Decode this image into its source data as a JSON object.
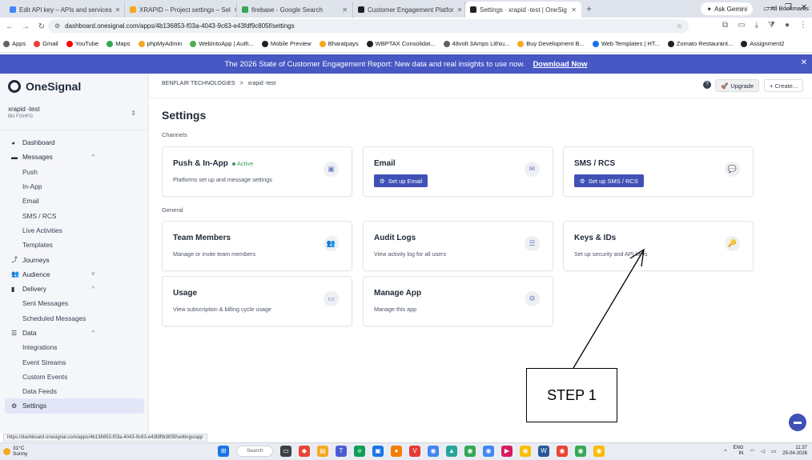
{
  "browser": {
    "tabs": [
      {
        "title": "Edit API key – APIs and services",
        "color": "#4285f4",
        "active": false
      },
      {
        "title": "XRAPID – Project settings – Sel",
        "color": "#f6a821",
        "active": false
      },
      {
        "title": "firebase - Google Search",
        "color": "#34a853",
        "active": false
      },
      {
        "title": "Customer Engagement Platfor",
        "color": "#202124",
        "active": false
      },
      {
        "title": "Settings · xrapid -test | OneSig",
        "color": "#202124",
        "active": true
      }
    ],
    "gemini_label": "Ask Gemini",
    "url": "dashboard.onesignal.com/apps/4b136853-f03a-4043-9c63-e43fdf9c805f/settings",
    "bookmarks": [
      {
        "label": "Apps",
        "color": "#5f6368"
      },
      {
        "label": "Gmail",
        "color": "#ea4335"
      },
      {
        "label": "YouTube",
        "color": "#ff0000"
      },
      {
        "label": "Maps",
        "color": "#34a853"
      },
      {
        "label": "phpMyAdmin",
        "color": "#f6a821"
      },
      {
        "label": "WebIntoApp | Auth...",
        "color": "#4caf50"
      },
      {
        "label": "Mobile Preview",
        "color": "#202124"
      },
      {
        "label": "Bharatpays",
        "color": "#f6a821"
      },
      {
        "label": "WBPTAX Consolidat...",
        "color": "#202124"
      },
      {
        "label": "48volt 3Amps Lithiu...",
        "color": "#5f6368"
      },
      {
        "label": "Buy Development B...",
        "color": "#f6a821"
      },
      {
        "label": "Web Templates | HT...",
        "color": "#1a73e8"
      },
      {
        "label": "Zomato Restaurant...",
        "color": "#202124"
      },
      {
        "label": "Assignment2",
        "color": "#202124"
      }
    ],
    "all_bookmarks_label": "All Bookmarks"
  },
  "banner": {
    "text": "The 2026 State of Customer Engagement Report: New data and real insights to use now.",
    "link": "Download Now",
    "close": "✕"
  },
  "sidebar": {
    "brand": "OneSignal",
    "app_name": "xrapid -test",
    "org_code": "BN FGHFG",
    "items": [
      {
        "label": "Dashboard",
        "icon": "◕",
        "type": "main",
        "chevron": ""
      },
      {
        "label": "Messages",
        "icon": "▬",
        "type": "main",
        "chevron": "^"
      },
      {
        "label": "Push",
        "icon": "",
        "type": "sub",
        "chevron": ""
      },
      {
        "label": "In-App",
        "icon": "",
        "type": "sub",
        "chevron": ""
      },
      {
        "label": "Email",
        "icon": "",
        "type": "sub",
        "chevron": ""
      },
      {
        "label": "SMS / RCS",
        "icon": "",
        "type": "sub",
        "chevron": ""
      },
      {
        "label": "Live Activities",
        "icon": "",
        "type": "sub",
        "chevron": ""
      },
      {
        "label": "Templates",
        "icon": "",
        "type": "sub",
        "chevron": ""
      },
      {
        "label": "Journeys",
        "icon": "⤴",
        "type": "main",
        "chevron": ""
      },
      {
        "label": "Audience",
        "icon": "👥",
        "type": "main",
        "chevron": "v"
      },
      {
        "label": "Delivery",
        "icon": "▮",
        "type": "main",
        "chevron": "^"
      },
      {
        "label": "Sent Messages",
        "icon": "",
        "type": "sub",
        "chevron": ""
      },
      {
        "label": "Scheduled Messages",
        "icon": "",
        "type": "sub",
        "chevron": ""
      },
      {
        "label": "Data",
        "icon": "☰",
        "type": "main",
        "chevron": "^"
      },
      {
        "label": "Integrations",
        "icon": "",
        "type": "sub",
        "chevron": ""
      },
      {
        "label": "Event Streams",
        "icon": "",
        "type": "sub",
        "chevron": ""
      },
      {
        "label": "Custom Events",
        "icon": "",
        "type": "sub",
        "chevron": ""
      },
      {
        "label": "Data Feeds",
        "icon": "",
        "type": "sub",
        "chevron": ""
      },
      {
        "label": "Settings",
        "icon": "⚙",
        "type": "active",
        "chevron": ""
      }
    ]
  },
  "header": {
    "breadcrumb_org": "BENFLAIR TECHNOLOGIES",
    "breadcrumb_sep": ">",
    "breadcrumb_app": "xrapid -test",
    "upgrade_label": "Upgrade",
    "create_label": "+ Create..."
  },
  "main": {
    "title": "Settings",
    "channels_label": "Channels",
    "general_label": "General",
    "channels": [
      {
        "title": "Push & In-App",
        "badge": "Active",
        "desc": "Platforms set up and message settings",
        "button": "",
        "icon": "▣"
      },
      {
        "title": "Email",
        "badge": "",
        "desc": "",
        "button": "Set up Email",
        "icon": "✉"
      },
      {
        "title": "SMS / RCS",
        "badge": "",
        "desc": "",
        "button": "Set up SMS / RCS",
        "icon": "💬"
      }
    ],
    "general": [
      {
        "title": "Team Members",
        "desc": "Manage or invite team members",
        "icon": "👥"
      },
      {
        "title": "Audit Logs",
        "desc": "View activity log for all users",
        "icon": "☰"
      },
      {
        "title": "Keys & IDs",
        "desc": "Set up security and API keys",
        "icon": "🔑"
      },
      {
        "title": "Usage",
        "desc": "View subscription & billing cycle usage",
        "icon": "▭"
      },
      {
        "title": "Manage App",
        "desc": "Manage this app",
        "icon": "⚙"
      }
    ]
  },
  "annotation": {
    "label": "STEP 1"
  },
  "status_url": "https://dashboard.onesignal.com/apps/4b136853-f03a-4043-9c63-e43fdf9c805f/settings/app",
  "taskbar": {
    "temp": "31°C",
    "condition": "Sunny",
    "search_label": "Search",
    "lang": "ENG",
    "region": "IN",
    "time": "11:37",
    "date": "25-04-2026"
  }
}
